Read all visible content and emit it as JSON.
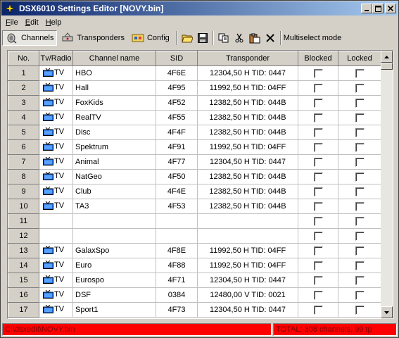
{
  "window": {
    "title": "DSX6010 Settings Editor   [NOVY.bin]"
  },
  "menu": [
    {
      "label": "File",
      "u": "F",
      "rest": "ile"
    },
    {
      "label": "Edit",
      "u": "E",
      "rest": "dit"
    },
    {
      "label": "Help",
      "u": "H",
      "rest": "elp"
    }
  ],
  "toolbar": {
    "channels_label": "Channels",
    "transponders_label": "Transponders",
    "config_label": "Config",
    "multiselect_label": "Multiselect mode"
  },
  "table": {
    "headers": [
      "No.",
      "Tv/Radio",
      "Channel name",
      "SID",
      "Transponder",
      "Blocked",
      "Locked"
    ],
    "rows": [
      {
        "no": "1",
        "type": "TV",
        "name": "HBO",
        "sid": "4F6E",
        "tp": "12304,50 H  TID: 0447"
      },
      {
        "no": "2",
        "type": "TV",
        "name": "Hall",
        "sid": "4F95",
        "tp": "11992,50 H  TID: 04FF"
      },
      {
        "no": "3",
        "type": "TV",
        "name": "FoxKids",
        "sid": "4F52",
        "tp": "12382,50 H  TID: 044B"
      },
      {
        "no": "4",
        "type": "TV",
        "name": "RealTV",
        "sid": "4F55",
        "tp": "12382,50 H  TID: 044B"
      },
      {
        "no": "5",
        "type": "TV",
        "name": "Disc",
        "sid": "4F4F",
        "tp": "12382,50 H  TID: 044B"
      },
      {
        "no": "6",
        "type": "TV",
        "name": "Spektrum",
        "sid": "4F91",
        "tp": "11992,50 H  TID: 04FF"
      },
      {
        "no": "7",
        "type": "TV",
        "name": "Animal",
        "sid": "4F77",
        "tp": "12304,50 H  TID: 0447"
      },
      {
        "no": "8",
        "type": "TV",
        "name": "NatGeo",
        "sid": "4F50",
        "tp": "12382,50 H  TID: 044B"
      },
      {
        "no": "9",
        "type": "TV",
        "name": "Club",
        "sid": "4F4E",
        "tp": "12382,50 H  TID: 044B"
      },
      {
        "no": "10",
        "type": "TV",
        "name": "TA3",
        "sid": "4F53",
        "tp": "12382,50 H  TID: 044B"
      },
      {
        "no": "11",
        "type": "",
        "name": "",
        "sid": "",
        "tp": ""
      },
      {
        "no": "12",
        "type": "",
        "name": "",
        "sid": "",
        "tp": ""
      },
      {
        "no": "13",
        "type": "TV",
        "name": "GalaxSpo",
        "sid": "4F8E",
        "tp": "11992,50 H  TID: 04FF"
      },
      {
        "no": "14",
        "type": "TV",
        "name": "Euro",
        "sid": "4F88",
        "tp": "11992,50 H  TID: 04FF"
      },
      {
        "no": "15",
        "type": "TV",
        "name": "Eurospo",
        "sid": "4F71",
        "tp": "12304,50 H  TID: 0447"
      },
      {
        "no": "16",
        "type": "TV",
        "name": "DSF",
        "sid": "0384",
        "tp": "12480,00 V  TID: 0021"
      },
      {
        "no": "17",
        "type": "TV",
        "name": "Sport1",
        "sid": "4F73",
        "tp": "12304,50 H  TID: 0447"
      }
    ]
  },
  "status": {
    "path": "C:\\dsxedit\\NOVY.bin",
    "total": "TOTAL: 308 channels, 99 tp"
  },
  "colors": {
    "title_start": "#0a246a",
    "status_bg": "#ff0000",
    "tv_icon": "#1e6ad6"
  }
}
